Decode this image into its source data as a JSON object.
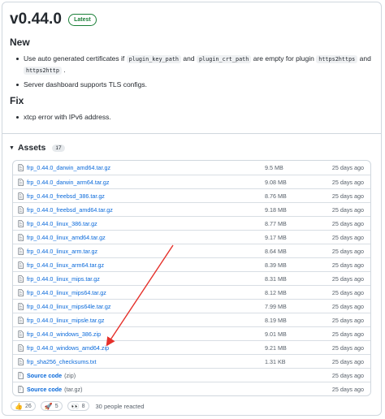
{
  "release": {
    "title": "v0.44.0",
    "badge": "Latest"
  },
  "sections": {
    "new": {
      "heading": "New",
      "item1_text_a": "Use auto generated certificates if",
      "item1_code_a": "plugin_key_path",
      "item1_text_b": "and",
      "item1_code_b": "plugin_crt_path",
      "item1_text_c": "are empty for plugin",
      "item1_code_c": "https2https",
      "item1_text_d": "and",
      "item1_code_d": "https2http",
      "item1_text_e": ".",
      "item2": "Server dashboard supports TLS configs."
    },
    "fix": {
      "heading": "Fix",
      "item1": "xtcp error with IPv6 address."
    }
  },
  "assets": {
    "heading": "Assets",
    "count": "17",
    "files": [
      {
        "name": "frp_0.44.0_darwin_amd64.tar.gz",
        "size": "9.5 MB",
        "date": "25 days ago"
      },
      {
        "name": "frp_0.44.0_darwin_arm64.tar.gz",
        "size": "9.08 MB",
        "date": "25 days ago"
      },
      {
        "name": "frp_0.44.0_freebsd_386.tar.gz",
        "size": "8.76 MB",
        "date": "25 days ago"
      },
      {
        "name": "frp_0.44.0_freebsd_amd64.tar.gz",
        "size": "9.18 MB",
        "date": "25 days ago"
      },
      {
        "name": "frp_0.44.0_linux_386.tar.gz",
        "size": "8.77 MB",
        "date": "25 days ago"
      },
      {
        "name": "frp_0.44.0_linux_amd64.tar.gz",
        "size": "9.17 MB",
        "date": "25 days ago"
      },
      {
        "name": "frp_0.44.0_linux_arm.tar.gz",
        "size": "8.64 MB",
        "date": "25 days ago"
      },
      {
        "name": "frp_0.44.0_linux_arm64.tar.gz",
        "size": "8.39 MB",
        "date": "25 days ago"
      },
      {
        "name": "frp_0.44.0_linux_mips.tar.gz",
        "size": "8.31 MB",
        "date": "25 days ago"
      },
      {
        "name": "frp_0.44.0_linux_mips64.tar.gz",
        "size": "8.12 MB",
        "date": "25 days ago"
      },
      {
        "name": "frp_0.44.0_linux_mips64le.tar.gz",
        "size": "7.99 MB",
        "date": "25 days ago"
      },
      {
        "name": "frp_0.44.0_linux_mipsle.tar.gz",
        "size": "8.19 MB",
        "date": "25 days ago"
      },
      {
        "name": "frp_0.44.0_windows_386.zip",
        "size": "9.01 MB",
        "date": "25 days ago"
      },
      {
        "name": "frp_0.44.0_windows_amd64.zip",
        "size": "9.21 MB",
        "date": "25 days ago"
      },
      {
        "name": "frp_sha256_checksums.txt",
        "size": "1.31 KB",
        "date": "25 days ago"
      }
    ],
    "source": [
      {
        "name": "Source code",
        "ext": "(zip)",
        "date": "25 days ago"
      },
      {
        "name": "Source code",
        "ext": "(tar.gz)",
        "date": "25 days ago"
      }
    ]
  },
  "reactions": {
    "thumbs_up": "26",
    "rocket": "5",
    "eyes": "8",
    "summary": "30 people reacted"
  },
  "colors": {
    "link": "#0969da",
    "latest_badge": "#1a7f37",
    "annotation_arrow": "#e5302a"
  }
}
